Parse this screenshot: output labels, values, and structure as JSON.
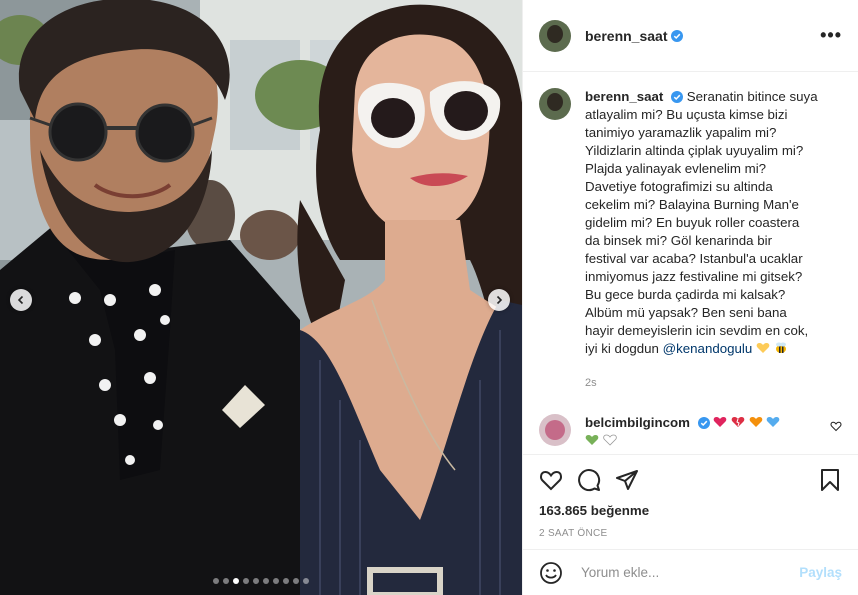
{
  "post": {
    "author": "berenn_saat",
    "caption_lines": [
      "Seranatin bitince suya",
      "atlayalim mi? Bu uçusta kimse bizi",
      "tanimiyo yaramazlik yapalim mi?",
      "Yildizlarin altinda çiplak uyuyalim mi?",
      "Plajda yalinayak evlenelim mi?",
      "Davetiye fotografimizi su altinda",
      "cekelim mi? Balayina Burning Man'e",
      "gidelim mi? En buyuk roller coastera",
      "da binsek mi? Göl kenarinda bir",
      "festival var acaba? Istanbul'a ucaklar",
      "inmiyomus jazz festivaline mi gitsek?",
      "Bu gece burda çadirda mi kalsak?",
      "Albüm mü yapsak? Ben seni bana",
      "hayir demeyislerin icin sevdim en cok,",
      "iyi ki dogdun"
    ],
    "mention": "@kenandogulu",
    "caption_time": "2s",
    "likes": "163.865 beğenme",
    "posted_ago": "2 SAAT ÖNCE"
  },
  "comment": {
    "author": "belcimbilgincom"
  },
  "add_comment": {
    "placeholder": "Yorum ekle...",
    "post_label": "Paylaş"
  },
  "carousel": {
    "slide_count": 10,
    "active_index": 2
  },
  "colors": {
    "verified": "#3897f0",
    "heart_red": "#e0245e",
    "heart_orange": "#f4900c",
    "heart_blue": "#55acee",
    "heart_green": "#78b159",
    "post_button": "#b2dffc"
  }
}
